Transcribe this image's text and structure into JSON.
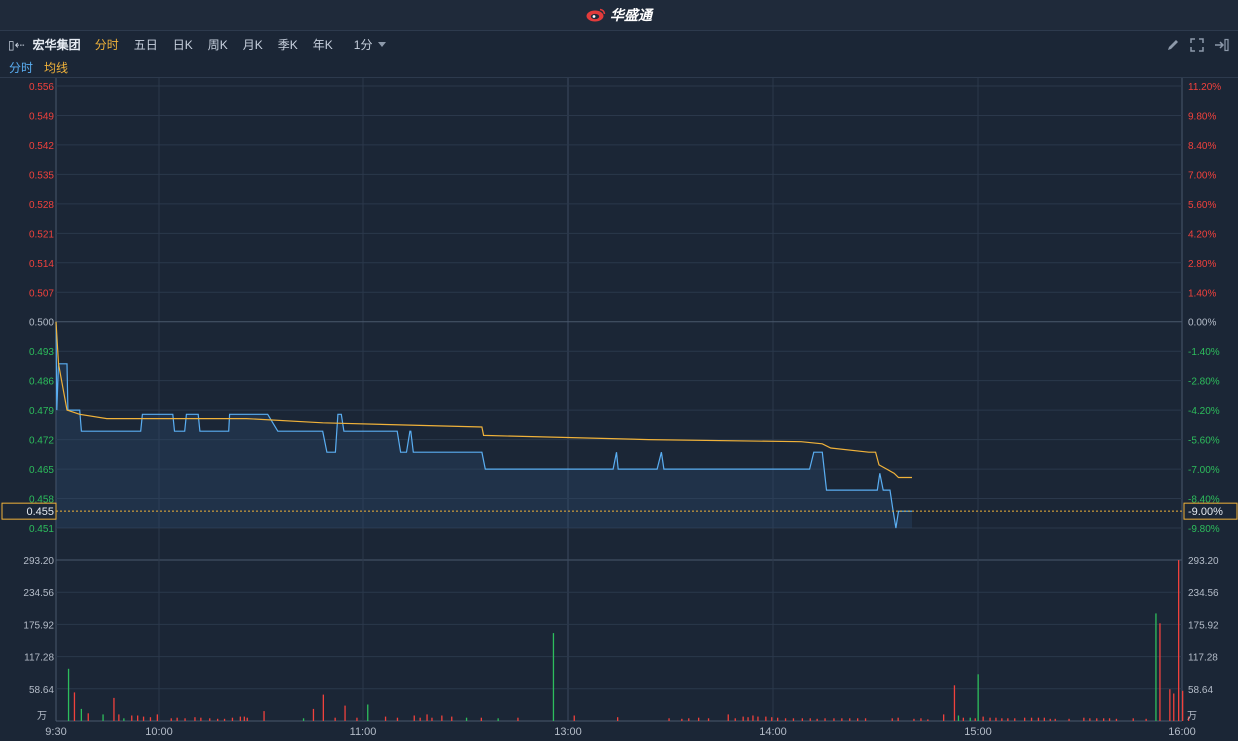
{
  "header": {
    "brand": "华盛通",
    "colors": {
      "logo": "#e23b3b"
    }
  },
  "toolbar": {
    "stock_name": "宏华集团",
    "tabs": [
      {
        "label": "分时",
        "active": true
      },
      {
        "label": "五日"
      },
      {
        "label": "日K"
      },
      {
        "label": "周K"
      },
      {
        "label": "月K"
      },
      {
        "label": "季K"
      },
      {
        "label": "年K"
      }
    ],
    "period": "1分",
    "icons": [
      "back-collapse-icon",
      "pencil-icon",
      "fullscreen-icon",
      "expand-panel-icon"
    ]
  },
  "legend": {
    "price_label": "分时",
    "avg_label": "均线",
    "price_color": "#5aaef2",
    "avg_color": "#f0b23a"
  },
  "chart_data": {
    "type": "line",
    "prev_close": 0.5,
    "current_price": "0.455",
    "current_change": "-9.00%",
    "x_ticks": [
      "9:30",
      "10:00",
      "11:00",
      "13:00",
      "14:00",
      "15:00",
      "16:00"
    ],
    "price_ticks": {
      "labels": [
        "0.556",
        "0.549",
        "0.542",
        "0.535",
        "0.528",
        "0.521",
        "0.514",
        "0.507",
        "0.500",
        "0.493",
        "0.486",
        "0.479",
        "0.472",
        "0.465",
        "0.458",
        "0.451"
      ],
      "values": [
        0.556,
        0.549,
        0.542,
        0.535,
        0.528,
        0.521,
        0.514,
        0.507,
        0.5,
        0.493,
        0.486,
        0.479,
        0.472,
        0.465,
        0.458,
        0.451
      ],
      "pct_labels": [
        "11.20%",
        "9.80%",
        "8.40%",
        "7.00%",
        "5.60%",
        "4.20%",
        "2.80%",
        "1.40%",
        "0.00%",
        "-1.40%",
        "-2.80%",
        "-4.20%",
        "-5.60%",
        "-7.00%",
        "-8.40%",
        "-9.80%"
      ]
    },
    "volume_ticks": {
      "labels": [
        "293.20",
        "234.56",
        "175.92",
        "117.28",
        "58.64"
      ],
      "values": [
        293.2,
        234.56,
        175.92,
        117.28,
        58.64
      ],
      "unit": "万"
    },
    "series": [
      {
        "name": "分时",
        "points": [
          [
            0,
            0.5
          ],
          [
            1,
            0.479
          ],
          [
            3,
            0.49
          ],
          [
            13,
            0.49
          ],
          [
            14,
            0.479
          ],
          [
            28,
            0.479
          ],
          [
            30,
            0.474
          ],
          [
            100,
            0.474
          ],
          [
            102,
            0.478
          ],
          [
            138,
            0.478
          ],
          [
            140,
            0.474
          ],
          [
            152,
            0.474
          ],
          [
            154,
            0.478
          ],
          [
            168,
            0.478
          ],
          [
            170,
            0.474
          ],
          [
            204,
            0.474
          ],
          [
            205,
            0.478
          ],
          [
            250,
            0.478
          ],
          [
            262,
            0.474
          ],
          [
            315,
            0.474
          ],
          [
            320,
            0.469
          ],
          [
            330,
            0.469
          ],
          [
            333,
            0.478
          ],
          [
            337,
            0.478
          ],
          [
            340,
            0.474
          ],
          [
            403,
            0.474
          ],
          [
            407,
            0.469
          ],
          [
            414,
            0.469
          ],
          [
            418,
            0.474
          ],
          [
            419,
            0.474
          ],
          [
            422,
            0.469
          ],
          [
            503,
            0.469
          ],
          [
            507,
            0.465
          ],
          [
            658,
            0.465
          ],
          [
            662,
            0.469
          ],
          [
            664,
            0.465
          ],
          [
            710,
            0.465
          ],
          [
            715,
            0.469
          ],
          [
            718,
            0.465
          ],
          [
            890,
            0.465
          ],
          [
            895,
            0.469
          ],
          [
            905,
            0.469
          ],
          [
            910,
            0.46
          ],
          [
            970,
            0.46
          ],
          [
            973,
            0.464
          ],
          [
            977,
            0.46
          ],
          [
            985,
            0.46
          ],
          [
            988,
            0.456
          ],
          [
            992,
            0.451
          ],
          [
            995,
            0.455
          ],
          [
            1011,
            0.455
          ]
        ]
      },
      {
        "name": "均线",
        "points": [
          [
            0,
            0.5
          ],
          [
            3,
            0.49
          ],
          [
            13,
            0.479
          ],
          [
            28,
            0.478
          ],
          [
            60,
            0.477
          ],
          [
            225,
            0.477
          ],
          [
            315,
            0.476
          ],
          [
            503,
            0.475
          ],
          [
            505,
            0.473
          ],
          [
            700,
            0.472
          ],
          [
            880,
            0.4715
          ],
          [
            905,
            0.471
          ],
          [
            915,
            0.47
          ],
          [
            960,
            0.469
          ],
          [
            968,
            0.469
          ],
          [
            972,
            0.466
          ],
          [
            990,
            0.464
          ],
          [
            995,
            0.463
          ],
          [
            1011,
            0.463
          ]
        ]
      }
    ],
    "volume": [
      [
        12,
        95,
        "g"
      ],
      [
        18,
        52,
        "r"
      ],
      [
        25,
        22,
        "g"
      ],
      [
        32,
        14,
        "r"
      ],
      [
        47,
        12,
        "g"
      ],
      [
        58,
        42,
        "r"
      ],
      [
        63,
        12,
        "r"
      ],
      [
        68,
        5,
        "g"
      ],
      [
        76,
        10,
        "r"
      ],
      [
        82,
        10,
        "r"
      ],
      [
        88,
        8,
        "r"
      ],
      [
        95,
        7,
        "r"
      ],
      [
        102,
        12,
        "r"
      ],
      [
        116,
        5,
        "r"
      ],
      [
        122,
        6,
        "r"
      ],
      [
        130,
        5,
        "r"
      ],
      [
        140,
        7,
        "r"
      ],
      [
        146,
        6,
        "r"
      ],
      [
        155,
        5,
        "r"
      ],
      [
        163,
        4,
        "r"
      ],
      [
        170,
        4,
        "r"
      ],
      [
        178,
        6,
        "r"
      ],
      [
        186,
        8,
        "r"
      ],
      [
        190,
        8,
        "r"
      ],
      [
        193,
        6,
        "r"
      ],
      [
        210,
        18,
        "r"
      ],
      [
        250,
        5,
        "g"
      ],
      [
        260,
        22,
        "r"
      ],
      [
        270,
        48,
        "r"
      ],
      [
        282,
        6,
        "r"
      ],
      [
        292,
        28,
        "r"
      ],
      [
        304,
        6,
        "r"
      ],
      [
        315,
        30,
        "g"
      ],
      [
        333,
        8,
        "r"
      ],
      [
        345,
        6,
        "r"
      ],
      [
        362,
        10,
        "r"
      ],
      [
        368,
        6,
        "r"
      ],
      [
        375,
        12,
        "r"
      ],
      [
        380,
        6,
        "r"
      ],
      [
        390,
        10,
        "r"
      ],
      [
        400,
        8,
        "r"
      ],
      [
        415,
        6,
        "g"
      ],
      [
        430,
        6,
        "r"
      ],
      [
        447,
        5,
        "g"
      ],
      [
        467,
        6,
        "r"
      ],
      [
        503,
        160,
        "g"
      ],
      [
        524,
        10,
        "r"
      ],
      [
        568,
        7,
        "r"
      ],
      [
        620,
        5,
        "r"
      ],
      [
        633,
        4,
        "r"
      ],
      [
        640,
        5,
        "r"
      ],
      [
        650,
        6,
        "r"
      ],
      [
        660,
        5,
        "r"
      ],
      [
        680,
        12,
        "r"
      ],
      [
        687,
        5,
        "r"
      ],
      [
        695,
        8,
        "r"
      ],
      [
        700,
        7,
        "r"
      ],
      [
        705,
        10,
        "r"
      ],
      [
        710,
        8,
        "r"
      ],
      [
        718,
        8,
        "r"
      ],
      [
        724,
        7,
        "r"
      ],
      [
        730,
        6,
        "r"
      ],
      [
        738,
        5,
        "r"
      ],
      [
        746,
        5,
        "r"
      ],
      [
        755,
        5,
        "r"
      ],
      [
        763,
        5,
        "r"
      ],
      [
        770,
        4,
        "r"
      ],
      [
        778,
        5,
        "r"
      ],
      [
        787,
        5,
        "r"
      ],
      [
        795,
        5,
        "r"
      ],
      [
        803,
        5,
        "r"
      ],
      [
        811,
        5,
        "r"
      ],
      [
        819,
        5,
        "r"
      ],
      [
        846,
        5,
        "r"
      ],
      [
        852,
        6,
        "r"
      ],
      [
        868,
        4,
        "r"
      ],
      [
        875,
        5,
        "r"
      ],
      [
        882,
        3,
        "r"
      ],
      [
        898,
        12,
        "r"
      ],
      [
        909,
        65,
        "r"
      ],
      [
        913,
        10,
        "g"
      ],
      [
        918,
        6,
        "r"
      ],
      [
        925,
        6,
        "g"
      ],
      [
        930,
        5,
        "r"
      ],
      [
        933,
        85,
        "g"
      ],
      [
        938,
        8,
        "r"
      ],
      [
        945,
        6,
        "r"
      ],
      [
        951,
        6,
        "r"
      ],
      [
        957,
        5,
        "r"
      ],
      [
        963,
        5,
        "r"
      ],
      [
        970,
        5,
        "r"
      ],
      [
        980,
        6,
        "r"
      ],
      [
        987,
        6,
        "r"
      ],
      [
        994,
        6,
        "r"
      ],
      [
        1000,
        6,
        "r"
      ],
      [
        1006,
        4,
        "r"
      ],
      [
        1011,
        4,
        "r"
      ],
      [
        1025,
        4,
        "r"
      ],
      [
        1040,
        6,
        "r"
      ],
      [
        1046,
        5,
        "r"
      ],
      [
        1053,
        5,
        "r"
      ],
      [
        1060,
        5,
        "r"
      ],
      [
        1066,
        5,
        "r"
      ],
      [
        1073,
        4,
        "r"
      ],
      [
        1090,
        5,
        "r"
      ],
      [
        1103,
        4,
        "r"
      ],
      [
        1113,
        196,
        "g"
      ],
      [
        1117,
        178,
        "r"
      ],
      [
        1127,
        58,
        "r"
      ],
      [
        1131,
        50,
        "r"
      ],
      [
        1136,
        293,
        "r"
      ],
      [
        1140,
        55,
        "r"
      ],
      [
        1146,
        8,
        "r"
      ]
    ],
    "colors": {
      "up": "#f0413c",
      "down": "#2dbd5c",
      "neutral": "#b4bcc8",
      "grid": "#2b384b",
      "baseline": "#4a586c",
      "current": "#f0b23a"
    }
  }
}
